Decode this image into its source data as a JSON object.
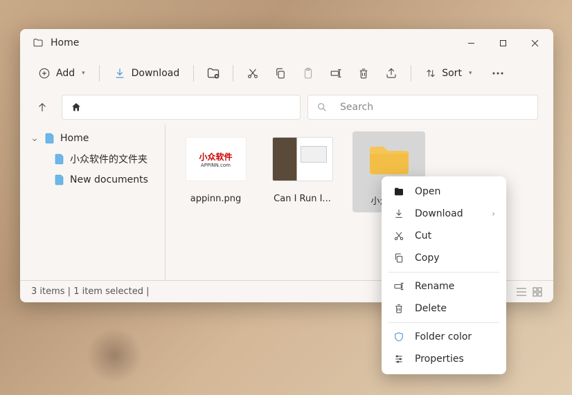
{
  "window": {
    "title": "Home",
    "controls": {
      "minimize": "−",
      "maximize": "□",
      "close": "✕"
    }
  },
  "toolbar": {
    "add_label": "Add",
    "download_label": "Download",
    "sort_label": "Sort"
  },
  "navbar": {
    "search_placeholder": "Search"
  },
  "sidebar": {
    "items": [
      {
        "label": "Home",
        "expandable": true
      },
      {
        "label": "小众软件的文件夹",
        "child": true
      },
      {
        "label": "New documents",
        "child": true
      }
    ]
  },
  "files": [
    {
      "name": "appinn.png",
      "thumb_line1": "小众软件",
      "thumb_line2": "APPINN.com"
    },
    {
      "name": "Can I Run I..."
    },
    {
      "name": "小众软件",
      "selected": true
    }
  ],
  "status": {
    "text": "3 items | 1 item selected |"
  },
  "context_menu": {
    "sections": [
      [
        {
          "icon": "folder",
          "label": "Open"
        },
        {
          "icon": "download",
          "label": "Download",
          "submenu": true
        },
        {
          "icon": "cut",
          "label": "Cut"
        },
        {
          "icon": "copy",
          "label": "Copy"
        }
      ],
      [
        {
          "icon": "rename",
          "label": "Rename"
        },
        {
          "icon": "delete",
          "label": "Delete"
        }
      ],
      [
        {
          "icon": "shield",
          "label": "Folder color"
        },
        {
          "icon": "properties",
          "label": "Properties"
        }
      ]
    ]
  }
}
